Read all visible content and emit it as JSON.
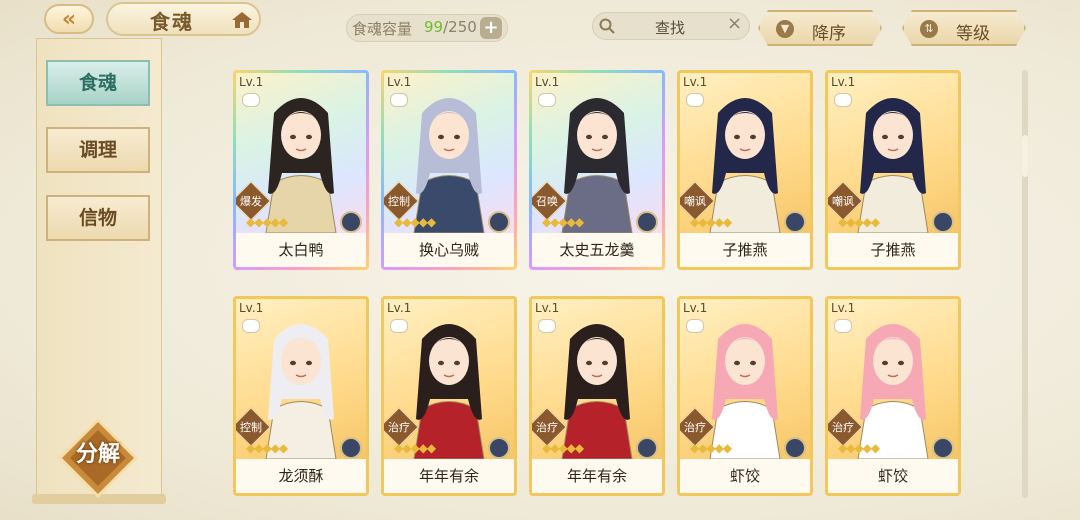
{
  "header": {
    "back_icon": "back-arrow-icon",
    "title": "食魂",
    "home_icon": "home-icon",
    "capacity_label": "食魂容量",
    "capacity_current": "99",
    "capacity_max": "/250",
    "capacity_add": "+",
    "search_placeholder": "查找",
    "search_clear": "×",
    "sort_order_label": "降序",
    "sort_key_label": "等级"
  },
  "sidebar": {
    "tabs": [
      {
        "label": "食魂",
        "active": true
      },
      {
        "label": "调理",
        "active": false
      },
      {
        "label": "信物",
        "active": false
      }
    ],
    "decompose_label": "分解"
  },
  "cards": [
    {
      "level": "Lv.1",
      "role": "爆发",
      "name": "太白鸭",
      "frame": "rainbow",
      "hair": "#2b2420",
      "cloth": "#e6d5a8"
    },
    {
      "level": "Lv.1",
      "role": "控制",
      "name": "换心乌贼",
      "frame": "rainbow",
      "hair": "#b7bdd6",
      "cloth": "#3a4a6a"
    },
    {
      "level": "Lv.1",
      "role": "召唤",
      "name": "太史五龙羹",
      "frame": "rainbow",
      "hair": "#2a2a30",
      "cloth": "#6a6d85"
    },
    {
      "level": "Lv.1",
      "role": "嘲讽",
      "name": "子推燕",
      "frame": "gold",
      "hair": "#23284a",
      "cloth": "#f2ecdc"
    },
    {
      "level": "Lv.1",
      "role": "嘲讽",
      "name": "子推燕",
      "frame": "gold",
      "hair": "#23284a",
      "cloth": "#f2ecdc"
    },
    {
      "level": "Lv.1",
      "role": "控制",
      "name": "龙须酥",
      "frame": "gold",
      "hair": "#ededf2",
      "cloth": "#f4efe2"
    },
    {
      "level": "Lv.1",
      "role": "治疗",
      "name": "年年有余",
      "frame": "gold",
      "hair": "#2a1f1c",
      "cloth": "#b5222a"
    },
    {
      "level": "Lv.1",
      "role": "治疗",
      "name": "年年有余",
      "frame": "gold",
      "hair": "#2a1f1c",
      "cloth": "#b5222a"
    },
    {
      "level": "Lv.1",
      "role": "治疗",
      "name": "虾饺",
      "frame": "gold",
      "hair": "#f6a8b4",
      "cloth": "#ffffff"
    },
    {
      "level": "Lv.1",
      "role": "治疗",
      "name": "虾饺",
      "frame": "gold",
      "hair": "#f6a8b4",
      "cloth": "#ffffff"
    }
  ],
  "colors": {
    "accent_gold": "#f2c85a",
    "active_tab": "#a8d2c7",
    "capacity_current": "#6cbf2a"
  }
}
